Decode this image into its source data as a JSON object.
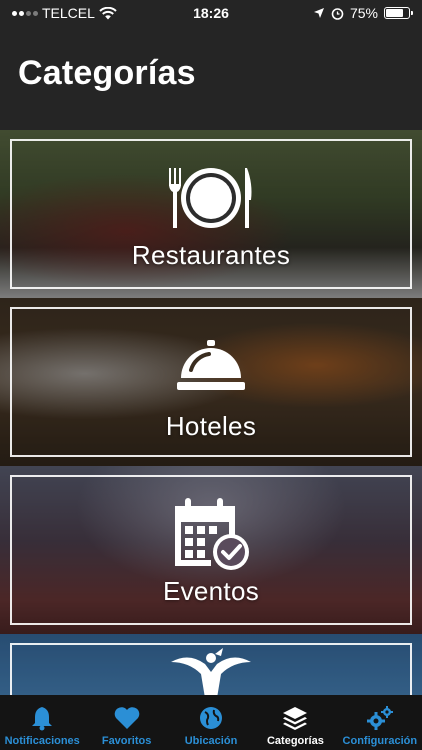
{
  "status_bar": {
    "carrier": "TELCEL",
    "time": "18:26",
    "battery_percent": "75%",
    "battery_level": 0.75
  },
  "header": {
    "title": "Categorías"
  },
  "categories": [
    {
      "label": "Restaurantes",
      "icon": "plate-cutlery-icon"
    },
    {
      "label": "Hoteles",
      "icon": "service-bell-icon"
    },
    {
      "label": "Eventos",
      "icon": "calendar-check-icon"
    },
    {
      "label": "",
      "icon": "angel-monument-icon"
    }
  ],
  "tab_bar": {
    "items": [
      {
        "label": "Notificaciones",
        "icon": "bell-icon",
        "active": false
      },
      {
        "label": "Favoritos",
        "icon": "heart-icon",
        "active": false
      },
      {
        "label": "Ubicación",
        "icon": "globe-icon",
        "active": false
      },
      {
        "label": "Categorías",
        "icon": "layers-icon",
        "active": true
      },
      {
        "label": "Configuración",
        "icon": "gears-icon",
        "active": false
      }
    ],
    "accent_color": "#2b8fd6",
    "active_color": "#ffffff"
  }
}
